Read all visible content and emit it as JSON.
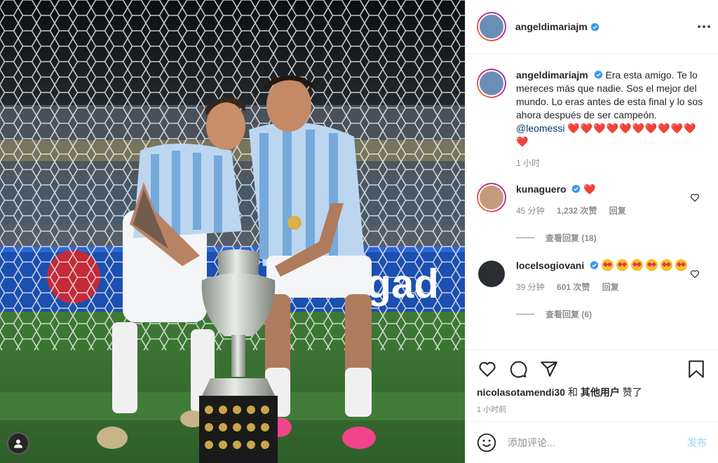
{
  "post": {
    "author": "angeldimariajm",
    "caption_text": "Era esta amigo. Te lo mereces más que nadie. Sos el mejor del mundo. Lo eras antes de esta final y lo sos ahora después de ser campeón.",
    "caption_mention": "@leomessi",
    "caption_hearts": "❤️❤️❤️❤️❤️❤️❤️❤️❤️❤️❤️",
    "caption_time": "1 小时",
    "photo_banner_text": "bligad"
  },
  "comments": [
    {
      "username": "kunaguero",
      "text": "❤️",
      "time": "45 分钟",
      "likes": "1,232 次赞",
      "reply_label": "回复",
      "view_replies": "查看回复 (18)"
    },
    {
      "username": "locelsogiovani",
      "text": "",
      "emoji_count": 6,
      "time": "39 分钟",
      "likes": "601 次赞",
      "reply_label": "回复",
      "view_replies": "查看回复 (6)"
    }
  ],
  "actions": {
    "liked_by_user": "nicolasotamendi30",
    "liked_and": "和",
    "liked_others": "其他用户",
    "liked_suffix": "赞了",
    "time": "1 小时前"
  },
  "add_comment": {
    "placeholder": "添加评论...",
    "post_label": "发布"
  },
  "icons": {
    "more": "more-icon",
    "like": "heart-icon",
    "comment": "comment-icon",
    "share": "paper-plane-icon",
    "save": "bookmark-icon",
    "emoji": "smiley-icon",
    "verified": "verified-badge-icon",
    "user": "user-icon"
  },
  "colors": {
    "verified_blue": "#3897f0",
    "heart_red": "#ed4956",
    "link_blue": "#00376b",
    "muted": "#8e8e8e",
    "post_disabled": "#b2dffc",
    "argentina_blue": "#75aadb"
  }
}
